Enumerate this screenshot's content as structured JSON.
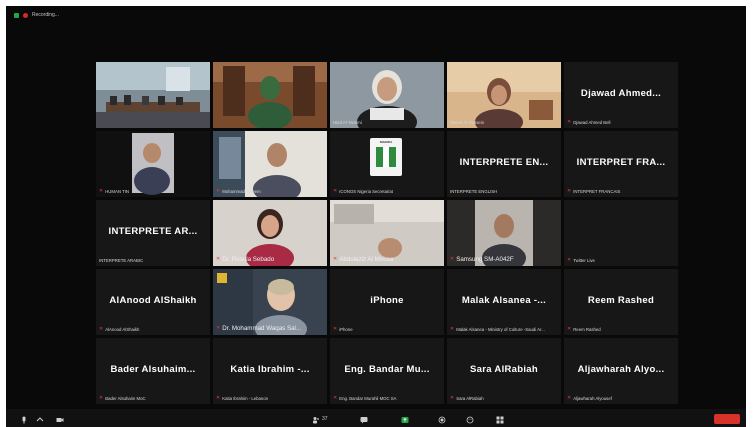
{
  "window": {
    "recording_label": "Recording..."
  },
  "tiles": [
    {
      "caption": ""
    },
    {
      "caption": ""
    },
    {
      "caption": "Hind Al-Tamimi"
    },
    {
      "caption": "Saeed Al-Hussein"
    },
    {
      "name": "Djawad Ahmed...",
      "caption": "Djawad Ahmed Bell"
    },
    {
      "caption": "HUMAN TIN"
    },
    {
      "caption": "Mohammad Saleem"
    },
    {
      "caption": "ICONOS Nigeria Secretariat",
      "logo_text": "NIGERIA"
    },
    {
      "name": "INTERPRETE EN...",
      "caption": "INTERPRETE ENGLISH"
    },
    {
      "name": "INTERPRET FRA...",
      "caption": "INTERPRET FRANCAIS"
    },
    {
      "name": "INTERPRETE AR...",
      "caption": "INTERPRETE ARABIC"
    },
    {
      "caption": "Dr. Rosula Sebado"
    },
    {
      "caption": "Abdulaziz Al Mousa"
    },
    {
      "caption": "Samsung SM-A042F"
    },
    {
      "caption": "Twitter Live"
    },
    {
      "name": "AlAnood AlShaikh",
      "caption": "AlAnood AlShaikh"
    },
    {
      "caption": "Dr. Mohammad Waqas Sal..."
    },
    {
      "name": "iPhone",
      "caption": "iPhone"
    },
    {
      "name": "Malak Alsanea -...",
      "caption": "Malak Alsanea - Ministry of Culture -Saudi Ar..."
    },
    {
      "name": "Reem Rashed",
      "caption": "Reem Rashed"
    },
    {
      "name": "Bader Alsuhaim...",
      "caption": "Bader Alsuhaim MoC"
    },
    {
      "name": "Katia Ibrahim -...",
      "caption": "Katia Ibrahim - Lebanon"
    },
    {
      "name": "Eng. Bandar Mu...",
      "caption": "Eng. Bandar Murahil MOC SA"
    },
    {
      "name": "Sara AlRabiah",
      "caption": "Sara AlRabiah"
    },
    {
      "name": "Aljawharah Alyo...",
      "caption": "Aljawharah Alyousef"
    }
  ],
  "toolbar": {
    "participants_count": "37"
  },
  "colors": {
    "active_speaker": "#3fcf6e",
    "muted_mic": "#e53a3a",
    "end_button": "#d8332a"
  }
}
